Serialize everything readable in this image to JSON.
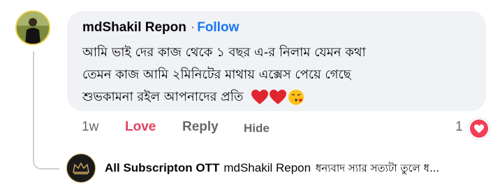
{
  "comment": {
    "author": "mdShakil Repon",
    "separator": "·",
    "follow_label": "Follow",
    "text_lines": [
      "আমি ভাই দের কাজ থেকে ১ বছর এ-র নিলাম যেমন কথা",
      "তেমন কাজ আমি ২মিনিটের মাথায় এক্সেস  পেয়ে গেছে",
      "শুভকামনা রইল আপনাদের প্রতি"
    ],
    "emojis": [
      "heart-icon",
      "heart-icon",
      "face-blowing-kiss-icon"
    ],
    "time": "1w",
    "love_label": "Love",
    "reply_label": "Reply",
    "hide_label": "Hide",
    "reaction_count": "1",
    "reaction_icon": "heart-reaction-icon"
  },
  "reply": {
    "author": "All Subscripton OTT",
    "mention": "mdShakil Repon",
    "text": "ধন্যবাদ স্যার সত্যটা তুলে ধ..."
  },
  "colors": {
    "bubble": "#f0f2f5",
    "follow": "#1877f2",
    "love": "#e4405f",
    "muted": "#65676b",
    "reaction": "#f33e58",
    "avatar_ring": "#e8d24a"
  }
}
